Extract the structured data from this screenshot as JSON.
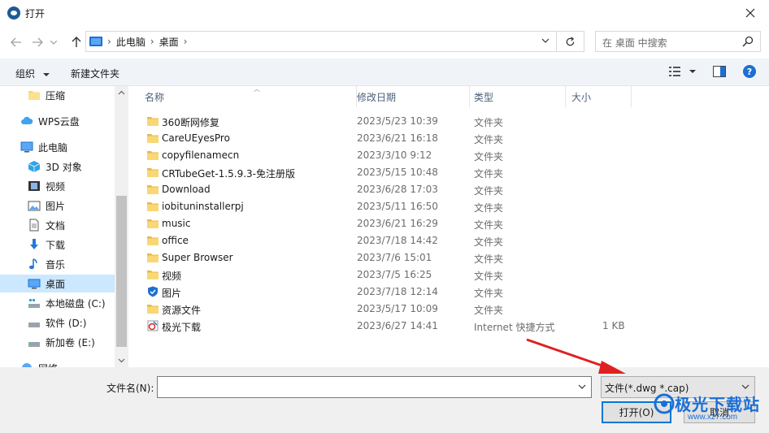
{
  "window": {
    "title": "打开"
  },
  "nav": {
    "breadcrumbs": [
      "此电脑",
      "桌面"
    ],
    "search_placeholder": "在 桌面 中搜索"
  },
  "toolbar": {
    "organize": "组织",
    "new_folder": "新建文件夹"
  },
  "sidebar": {
    "items": [
      {
        "label": "压缩",
        "icon": "folder-icon",
        "selected": false
      },
      {
        "label": "WPS云盘",
        "icon": "cloud-icon",
        "selected": false
      },
      {
        "label": "此电脑",
        "icon": "computer-icon",
        "selected": false
      },
      {
        "label": "3D 对象",
        "icon": "3d-objects-icon",
        "selected": false
      },
      {
        "label": "视频",
        "icon": "video-icon",
        "selected": false
      },
      {
        "label": "图片",
        "icon": "pictures-icon",
        "selected": false
      },
      {
        "label": "文档",
        "icon": "documents-icon",
        "selected": false
      },
      {
        "label": "下载",
        "icon": "download-icon",
        "selected": false
      },
      {
        "label": "音乐",
        "icon": "music-icon",
        "selected": false
      },
      {
        "label": "桌面",
        "icon": "desktop-icon",
        "selected": true
      },
      {
        "label": "本地磁盘 (C:)",
        "icon": "drive-icon",
        "selected": false
      },
      {
        "label": "软件 (D:)",
        "icon": "drive-icon",
        "selected": false
      },
      {
        "label": "新加卷 (E:)",
        "icon": "drive-icon",
        "selected": false
      },
      {
        "label": "网络",
        "icon": "network-icon",
        "selected": false
      }
    ]
  },
  "columns": {
    "name": "名称",
    "date": "修改日期",
    "type": "类型",
    "size": "大小"
  },
  "files": [
    {
      "name": "360断网修复",
      "date": "2023/5/23 10:39",
      "type": "文件夹",
      "size": "",
      "icon": "folder-icon"
    },
    {
      "name": "CareUEyesPro",
      "date": "2023/6/21 16:18",
      "type": "文件夹",
      "size": "",
      "icon": "folder-icon"
    },
    {
      "name": "copyfilenamecn",
      "date": "2023/3/10 9:12",
      "type": "文件夹",
      "size": "",
      "icon": "folder-icon"
    },
    {
      "name": "CRTubeGet-1.5.9.3-免注册版",
      "date": "2023/5/15 10:48",
      "type": "文件夹",
      "size": "",
      "icon": "folder-icon"
    },
    {
      "name": "Download",
      "date": "2023/6/28 17:03",
      "type": "文件夹",
      "size": "",
      "icon": "folder-icon"
    },
    {
      "name": "iobituninstallerpj",
      "date": "2023/5/11 16:50",
      "type": "文件夹",
      "size": "",
      "icon": "folder-icon"
    },
    {
      "name": "music",
      "date": "2023/6/21 16:29",
      "type": "文件夹",
      "size": "",
      "icon": "folder-icon"
    },
    {
      "name": "office",
      "date": "2023/7/18 14:42",
      "type": "文件夹",
      "size": "",
      "icon": "folder-icon"
    },
    {
      "name": "Super Browser",
      "date": "2023/7/6 15:01",
      "type": "文件夹",
      "size": "",
      "icon": "folder-icon"
    },
    {
      "name": "视频",
      "date": "2023/7/5 16:25",
      "type": "文件夹",
      "size": "",
      "icon": "folder-icon"
    },
    {
      "name": "图片",
      "date": "2023/7/18 12:14",
      "type": "文件夹",
      "size": "",
      "icon": "shield-folder-icon"
    },
    {
      "name": "资源文件",
      "date": "2023/5/17 10:09",
      "type": "文件夹",
      "size": "",
      "icon": "folder-icon"
    },
    {
      "name": "极光下载",
      "date": "2023/6/27 14:41",
      "type": "Internet 快捷方式",
      "size": "1 KB",
      "icon": "internet-shortcut-icon"
    }
  ],
  "bottom": {
    "filename_label": "文件名(N):",
    "filename_value": "",
    "filetype": "文件(*.dwg *.cap)",
    "open_button": "打开(O)",
    "cancel_button": "取消"
  },
  "watermark": {
    "text": "极光下载站",
    "url": "www.xz7.com"
  },
  "colors": {
    "accent": "#0078d7",
    "selected_bg": "#cce8ff",
    "folder": "#f8d775",
    "annotation": "#e02020"
  }
}
